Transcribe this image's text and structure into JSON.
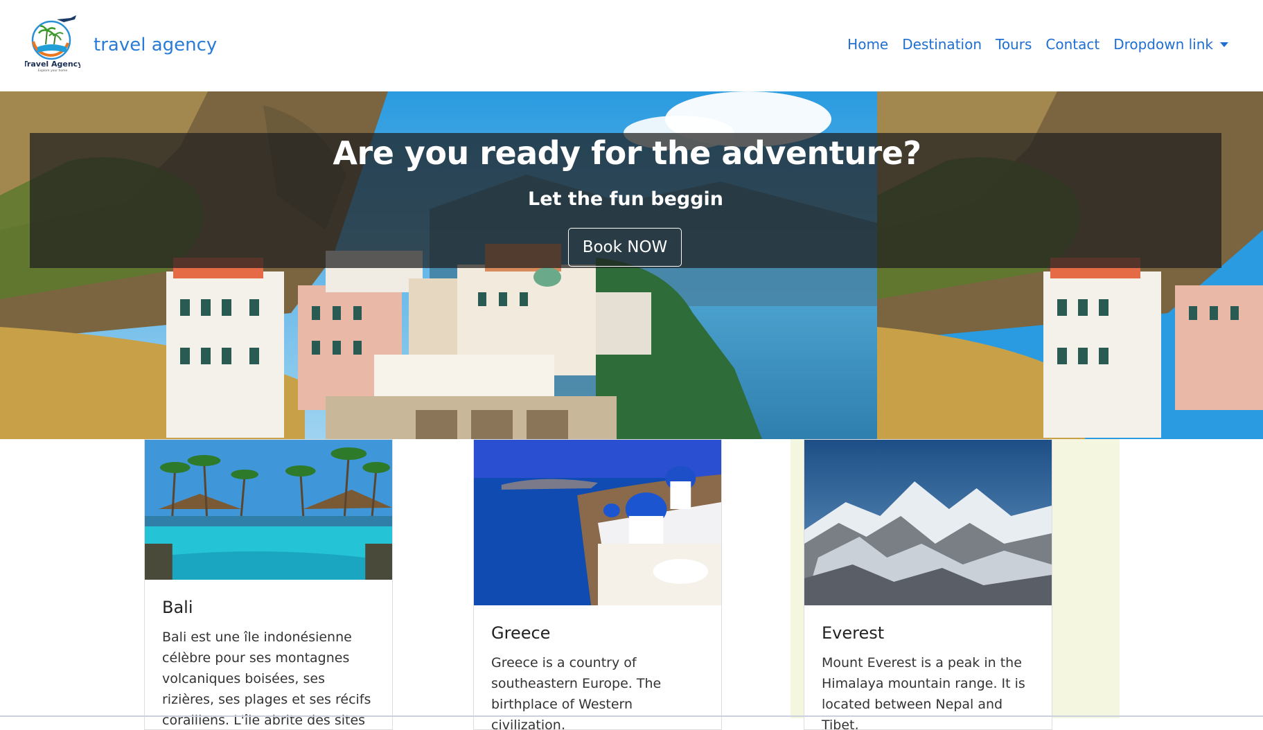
{
  "navbar": {
    "logo_text": "Travel Agency",
    "logo_tagline": "Explore your home",
    "brand": "travel agency",
    "links": [
      {
        "label": "Home"
      },
      {
        "label": "Destination"
      },
      {
        "label": "Tours"
      },
      {
        "label": "Contact"
      },
      {
        "label": "Dropdown link"
      }
    ]
  },
  "hero": {
    "title": "Are you ready for the adventure?",
    "subtitle": "Let the fun beggin",
    "button": "Book NOW"
  },
  "cards": [
    {
      "title": "Bali",
      "text": "Bali est une île indonésienne célèbre pour ses montagnes volcaniques boisées, ses rizières, ses plages et ses récifs coralliens. L'île abrite des sites religieux"
    },
    {
      "title": "Greece",
      "text": "Greece is a country of southeastern Europe. The birthplace of Western civilization,"
    },
    {
      "title": "Everest",
      "text": "Mount Everest is a peak in the Himalaya mountain range. It is located between Nepal and Tibet,"
    }
  ],
  "colors": {
    "brand_blue": "#2a7bd6",
    "nav_link": "#1f6ed1",
    "highlight_column": "#f4f6df"
  }
}
